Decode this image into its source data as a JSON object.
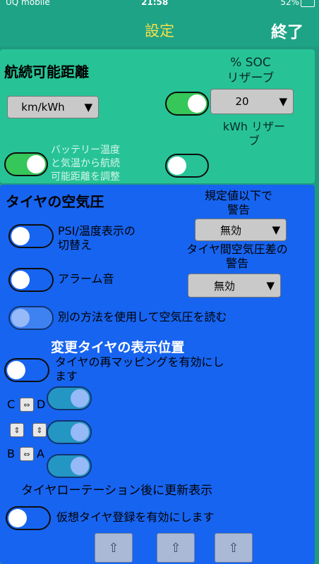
{
  "status": {
    "carrier": "UQ mobile",
    "time": "21:58",
    "battery": "52%"
  },
  "nav": {
    "title": "設定",
    "done": "終了"
  },
  "range": {
    "heading": "航続可能距離",
    "soc_label": "% SOC\nリザーブ",
    "unit_select": "km/kWh",
    "soc_select": "20",
    "kwh_reserve": "kWh リザー\nブ",
    "adjust_label": "バッテリー温度\nと気温から航続\n可能距離を調整"
  },
  "tire": {
    "heading": "タイヤの空気圧",
    "warn_below": "規定値以下で\n警告",
    "warn_below_select": "無効",
    "psi_toggle_label": "PSI/温度表示の\n切替え",
    "diff_warn": "タイヤ間空気圧差の\n警告",
    "diff_select": "無効",
    "alarm_label": "アラーム音",
    "alt_method_label": "別の方法を使用して空気圧を読む",
    "position_heading": "変更タイヤの表示位置",
    "remap_label": "タイヤの再マッピングを有効にし\nます",
    "cd_label": "C",
    "cd_label2": "D",
    "ba_label": "B",
    "ba_label2": "A",
    "rotation_label": "タイヤローテーション後に更新表示",
    "virtual_label": "仮想タイヤ登録を有効にします",
    "swap_arrow": "⇔",
    "vswap_arrow": "⇕",
    "up_arrow": "⇧"
  }
}
